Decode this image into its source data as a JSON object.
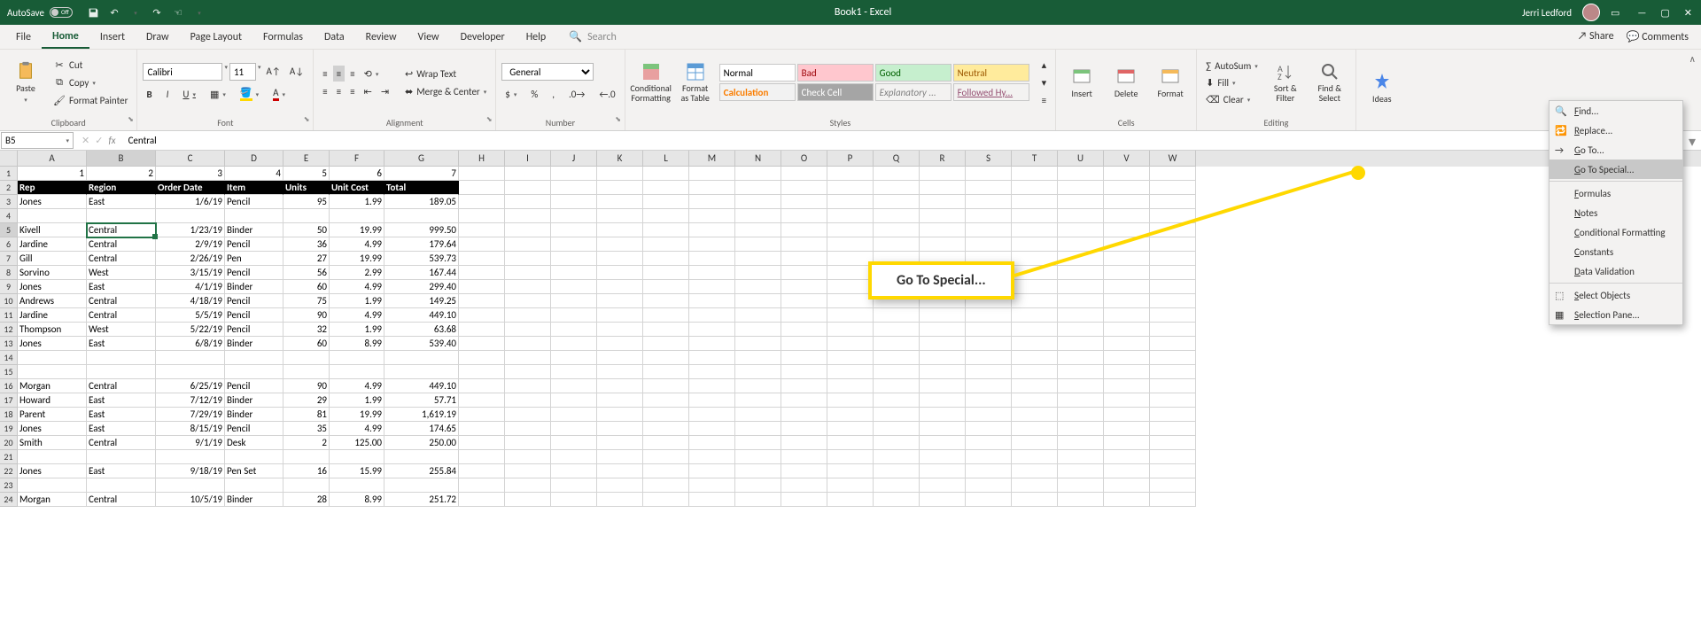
{
  "titlebar": {
    "autosave": "AutoSave",
    "autosave_state": "Off",
    "title": "Book1 - Excel",
    "user": "Jerri Ledford"
  },
  "menu": {
    "tabs": [
      "File",
      "Home",
      "Insert",
      "Draw",
      "Page Layout",
      "Formulas",
      "Data",
      "Review",
      "View",
      "Developer",
      "Help"
    ],
    "active": 1,
    "search_placeholder": "Search",
    "share": "Share",
    "comments": "Comments"
  },
  "ribbon": {
    "clipboard": {
      "paste": "Paste",
      "cut": "Cut",
      "copy": "Copy",
      "format_painter": "Format Painter",
      "label": "Clipboard"
    },
    "font": {
      "name": "Calibri",
      "size": "11",
      "label": "Font"
    },
    "alignment": {
      "wrap": "Wrap Text",
      "merge": "Merge & Center",
      "label": "Alignment"
    },
    "number": {
      "format": "General",
      "label": "Number"
    },
    "styles": {
      "cond": "Conditional Formatting",
      "fat": "Format as Table",
      "cells": [
        "Normal",
        "Bad",
        "Good",
        "Neutral",
        "Calculation",
        "Check Cell",
        "Explanatory ...",
        "Followed Hy..."
      ],
      "label": "Styles"
    },
    "cells_grp": {
      "insert": "Insert",
      "delete": "Delete",
      "format": "Format",
      "label": "Cells"
    },
    "editing": {
      "autosum": "AutoSum",
      "fill": "Fill",
      "clear": "Clear",
      "sort": "Sort & Filter",
      "find": "Find & Select",
      "label": "Editing"
    },
    "ideas": "Ideas"
  },
  "namebox": "B5",
  "formula_bar": "Central",
  "columns": [
    "A",
    "B",
    "C",
    "D",
    "E",
    "F",
    "G",
    "H",
    "I",
    "J",
    "K",
    "L",
    "M",
    "N",
    "O",
    "P",
    "Q",
    "R",
    "S",
    "T",
    "U",
    "V",
    "W"
  ],
  "col_nums": [
    "1",
    "2",
    "3",
    "4",
    "5",
    "6",
    "7"
  ],
  "headers": {
    "A": "Rep",
    "B": "Region",
    "C": "Order Date",
    "D": "Item",
    "E": "Units",
    "F": "Unit Cost",
    "G": "Total"
  },
  "active_cell": {
    "row": 5,
    "col": "B"
  },
  "rows": [
    {
      "n": 3,
      "A": "Jones",
      "B": "East",
      "C": "1/6/19",
      "D": "Pencil",
      "E": "95",
      "F": "1.99",
      "G": "189.05"
    },
    {
      "n": 4
    },
    {
      "n": 5,
      "A": "Kivell",
      "B": "Central",
      "C": "1/23/19",
      "D": "Binder",
      "E": "50",
      "F": "19.99",
      "G": "999.50"
    },
    {
      "n": 6,
      "A": "Jardine",
      "B": "Central",
      "C": "2/9/19",
      "D": "Pencil",
      "E": "36",
      "F": "4.99",
      "G": "179.64"
    },
    {
      "n": 7,
      "A": "Gill",
      "B": "Central",
      "C": "2/26/19",
      "D": "Pen",
      "E": "27",
      "F": "19.99",
      "G": "539.73"
    },
    {
      "n": 8,
      "A": "Sorvino",
      "B": "West",
      "C": "3/15/19",
      "D": "Pencil",
      "E": "56",
      "F": "2.99",
      "G": "167.44"
    },
    {
      "n": 9,
      "A": "Jones",
      "B": "East",
      "C": "4/1/19",
      "D": "Binder",
      "E": "60",
      "F": "4.99",
      "G": "299.40"
    },
    {
      "n": 10,
      "A": "Andrews",
      "B": "Central",
      "C": "4/18/19",
      "D": "Pencil",
      "E": "75",
      "F": "1.99",
      "G": "149.25"
    },
    {
      "n": 11,
      "A": "Jardine",
      "B": "Central",
      "C": "5/5/19",
      "D": "Pencil",
      "E": "90",
      "F": "4.99",
      "G": "449.10"
    },
    {
      "n": 12,
      "A": "Thompson",
      "B": "West",
      "C": "5/22/19",
      "D": "Pencil",
      "E": "32",
      "F": "1.99",
      "G": "63.68"
    },
    {
      "n": 13,
      "A": "Jones",
      "B": "East",
      "C": "6/8/19",
      "D": "Binder",
      "E": "60",
      "F": "8.99",
      "G": "539.40"
    },
    {
      "n": 14
    },
    {
      "n": 15
    },
    {
      "n": 16,
      "A": "Morgan",
      "B": "Central",
      "C": "6/25/19",
      "D": "Pencil",
      "E": "90",
      "F": "4.99",
      "G": "449.10"
    },
    {
      "n": 17,
      "A": "Howard",
      "B": "East",
      "C": "7/12/19",
      "D": "Binder",
      "E": "29",
      "F": "1.99",
      "G": "57.71"
    },
    {
      "n": 18,
      "A": "Parent",
      "B": "East",
      "C": "7/29/19",
      "D": "Binder",
      "E": "81",
      "F": "19.99",
      "G": "1,619.19"
    },
    {
      "n": 19,
      "A": "Jones",
      "B": "East",
      "C": "8/15/19",
      "D": "Pencil",
      "E": "35",
      "F": "4.99",
      "G": "174.65"
    },
    {
      "n": 20,
      "A": "Smith",
      "B": "Central",
      "C": "9/1/19",
      "D": "Desk",
      "E": "2",
      "F": "125.00",
      "G": "250.00"
    },
    {
      "n": 21
    },
    {
      "n": 22,
      "A": "Jones",
      "B": "East",
      "C": "9/18/19",
      "D": "Pen Set",
      "E": "16",
      "F": "15.99",
      "G": "255.84"
    },
    {
      "n": 23
    },
    {
      "n": 24,
      "A": "Morgan",
      "B": "Central",
      "C": "10/5/19",
      "D": "Binder",
      "E": "28",
      "F": "8.99",
      "G": "251.72"
    }
  ],
  "find_menu": {
    "items": [
      "Find...",
      "Replace...",
      "Go To...",
      "Go To Special...",
      "Formulas",
      "Notes",
      "Conditional Formatting",
      "Constants",
      "Data Validation",
      "Select Objects",
      "Selection Pane..."
    ],
    "highlighted": 3
  },
  "callout": "Go To Special..."
}
